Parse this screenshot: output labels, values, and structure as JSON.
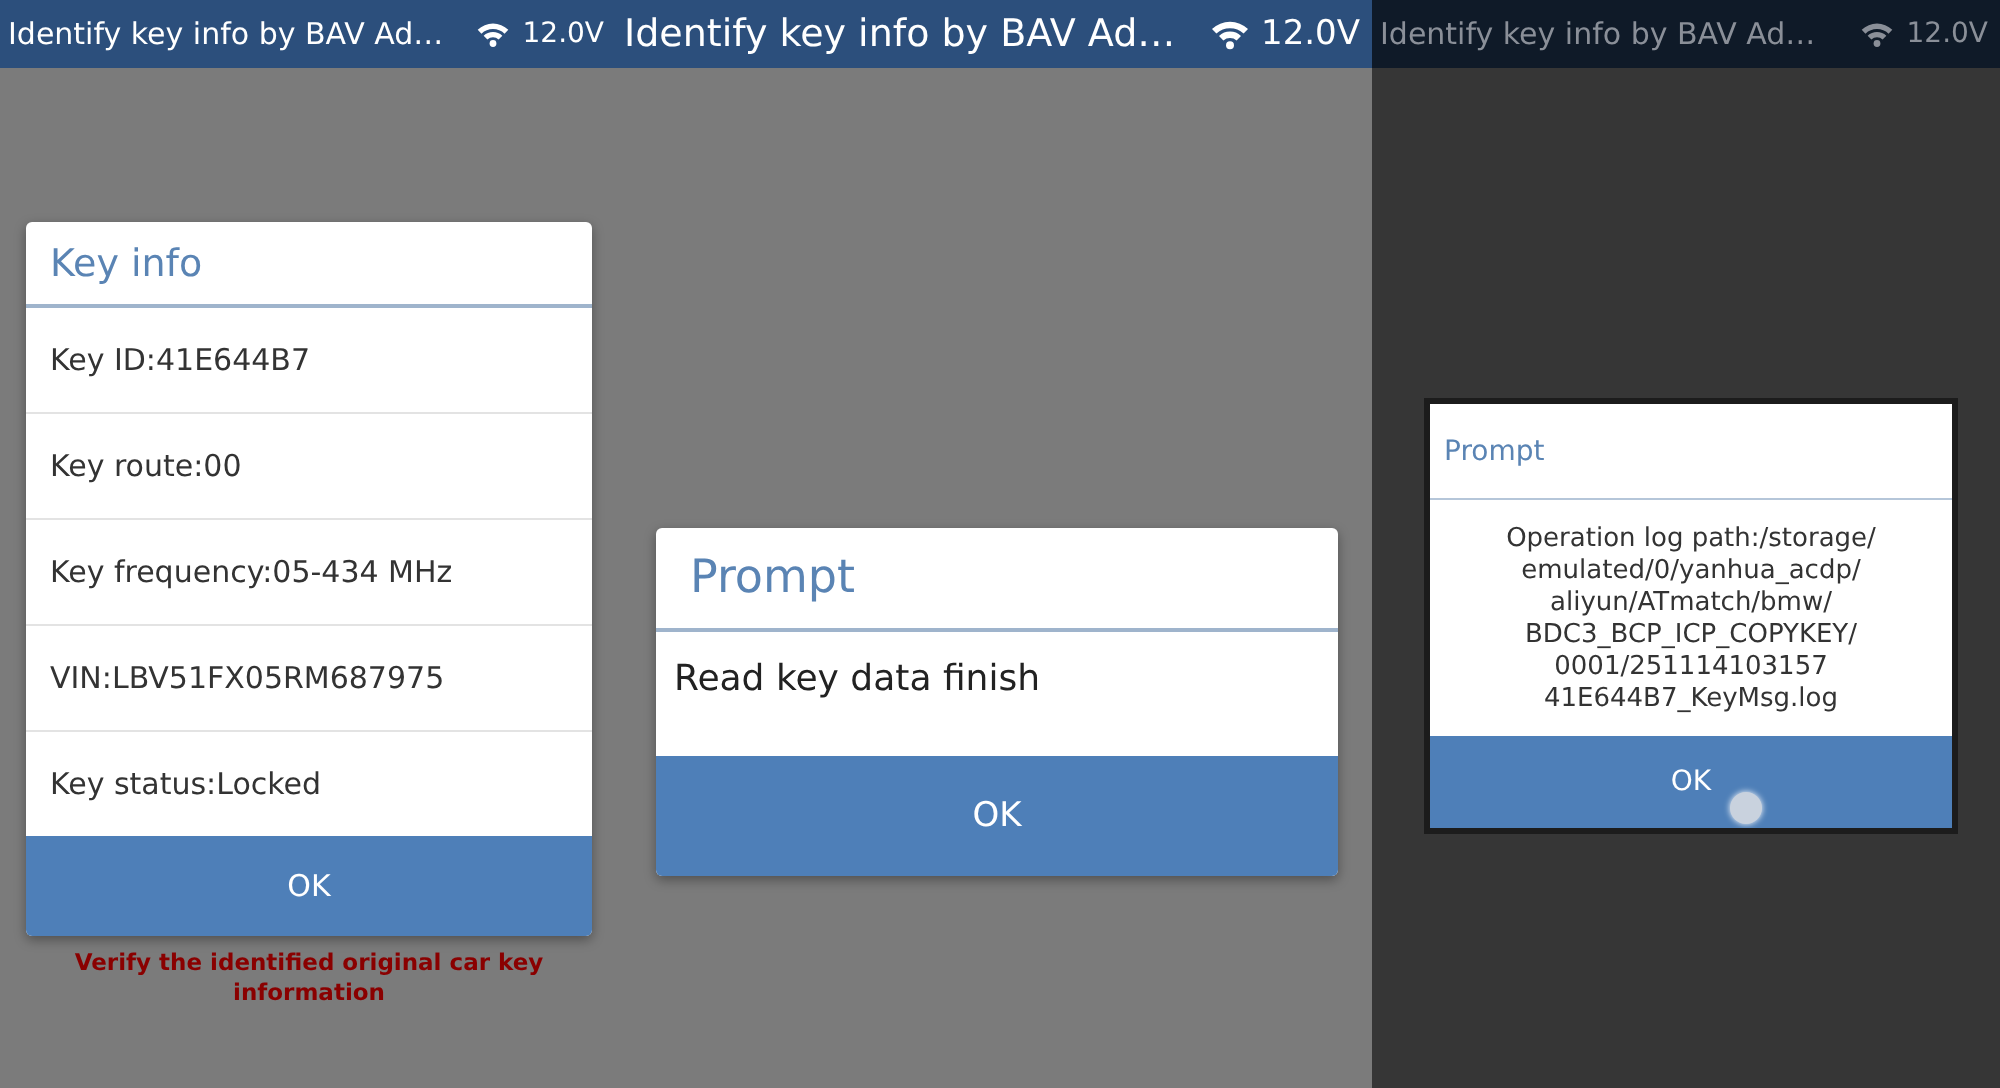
{
  "panels": [
    {
      "status_bar": {
        "title": "Identify key info by BAV Ad…",
        "voltage": "12.0V"
      },
      "dimmed": false,
      "dialog": {
        "kind": "list",
        "title": "Key info",
        "rows": [
          "Key ID:41E644B7",
          "Key route:00",
          "Key frequency:05-434 MHz",
          "VIN:LBV51FX05RM687975",
          "Key status:Locked"
        ],
        "button": "OK",
        "touch_indicator": false
      },
      "caption": "Verify the identified original car key information"
    },
    {
      "status_bar": {
        "title": "Identify key info by BAV Ad…",
        "voltage": "12.0V"
      },
      "dimmed": false,
      "dialog": {
        "kind": "message",
        "title": "Prompt",
        "message": "Read key data finish",
        "button": "OK",
        "touch_indicator": false
      }
    },
    {
      "status_bar": {
        "title": "Identify key info by BAV Ad…",
        "voltage": "12.0V"
      },
      "dimmed": true,
      "dialog": {
        "kind": "centered_message",
        "title": "Prompt",
        "message": "Operation log path:/storage/\nemulated/0/yanhua_acdp/\naliyun/ATmatch/bmw/\nBDC3_BCP_ICP_COPYKEY/\n0001/251114103157\n41E644B7_KeyMsg.log",
        "button": "OK",
        "touch_indicator": true
      }
    }
  ]
}
